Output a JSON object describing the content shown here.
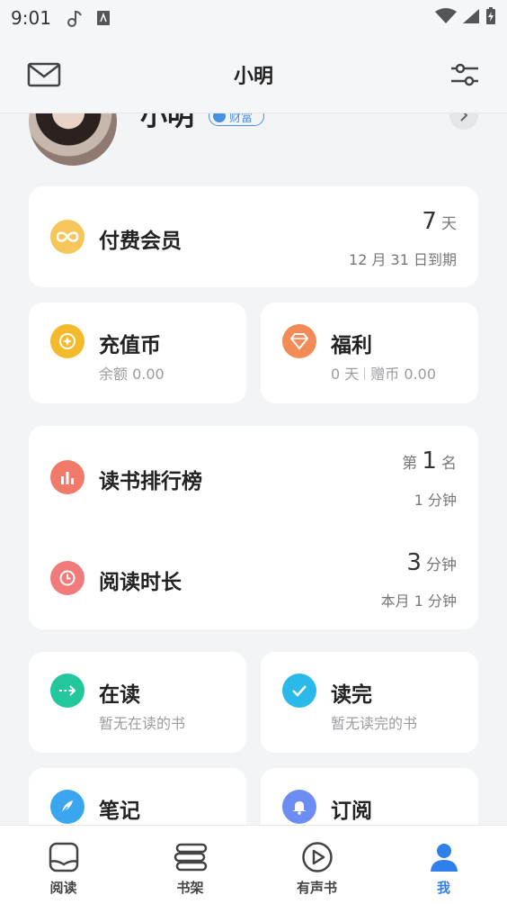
{
  "status_bar": {
    "time": "9:01"
  },
  "header": {
    "title": "小明"
  },
  "profile": {
    "name": "小明",
    "badge": "财富"
  },
  "membership": {
    "title": "付费会员",
    "days": "7",
    "days_unit": "天",
    "expiry": "12 月 31 日到期"
  },
  "recharge": {
    "title": "充值币",
    "balance": "余额 0.00"
  },
  "welfare": {
    "title": "福利",
    "days": "0 天",
    "gift": "赠币 0.00"
  },
  "ranking": {
    "title": "读书排行榜",
    "prefix": "第",
    "rank": "1",
    "suffix": "名",
    "detail": "1 分钟"
  },
  "reading_time": {
    "title": "阅读时长",
    "value": "3",
    "unit": "分钟",
    "detail": "本月 1 分钟"
  },
  "reading_now": {
    "title": "在读",
    "subtitle": "暂无在读的书"
  },
  "finished": {
    "title": "读完",
    "subtitle": "暂无读完的书"
  },
  "notes": {
    "title": "笔记"
  },
  "subscriptions": {
    "title": "订阅"
  },
  "bottom_nav": [
    {
      "label": "阅读",
      "icon": "read-icon"
    },
    {
      "label": "书架",
      "icon": "bookshelf-icon"
    },
    {
      "label": "有声书",
      "icon": "audiobook-icon"
    },
    {
      "label": "我",
      "icon": "profile-icon",
      "active": true
    }
  ],
  "colors": {
    "accent": "#2f80ed",
    "membership_icon": "#f7c65b",
    "recharge_icon": "#f5b92c",
    "welfare_icon": "#f38b56",
    "ranking_icon": "#f27a6a",
    "reading_time_icon": "#f27a7a",
    "reading_now_icon": "#22c79b",
    "finished_icon": "#2bb9ea",
    "notes_icon": "#3aa6f0",
    "subscriptions_icon": "#6c8ef2"
  }
}
